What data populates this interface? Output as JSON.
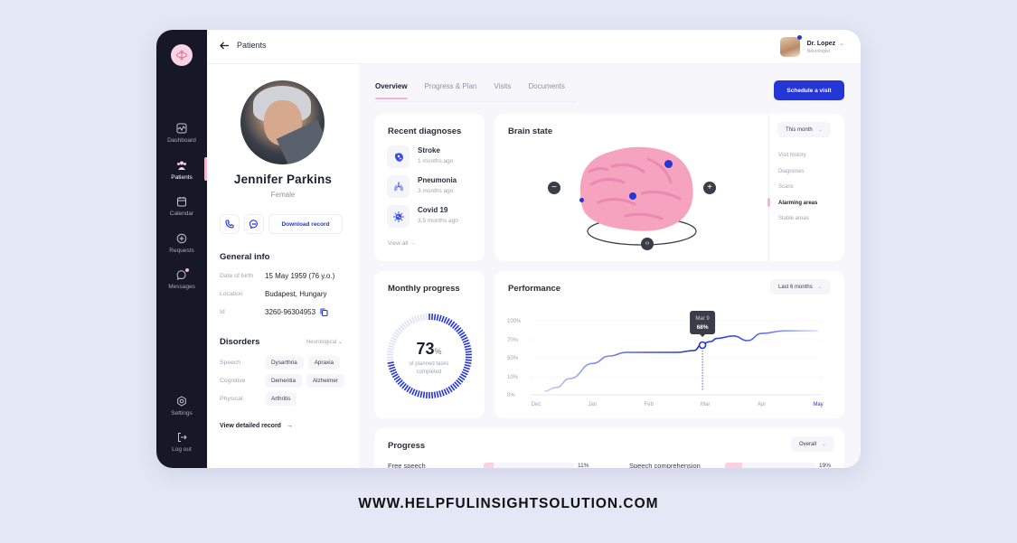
{
  "sidebar": {
    "items": [
      {
        "label": "Dashboard",
        "icon": "dashboard-icon"
      },
      {
        "label": "Patients",
        "icon": "patients-icon",
        "active": true
      },
      {
        "label": "Calendar",
        "icon": "calendar-icon"
      },
      {
        "label": "Requests",
        "icon": "requests-icon"
      },
      {
        "label": "Messages",
        "icon": "messages-icon",
        "badge": true
      }
    ],
    "bottom_items": [
      {
        "label": "Settings",
        "icon": "settings-icon"
      },
      {
        "label": "Log out",
        "icon": "logout-icon"
      }
    ]
  },
  "topbar": {
    "back_label": "Patients",
    "doctor": {
      "name": "Dr. Lopez",
      "role": "Neurologist"
    }
  },
  "patient": {
    "name": "Jennifer Parkins",
    "gender": "Female",
    "download_label": "Download record",
    "general_info_title": "General info",
    "info": [
      {
        "key": "Date of birth",
        "value": "15 May 1959 (76 y.o.)"
      },
      {
        "key": "Location",
        "value": "Budapest, Hungary"
      },
      {
        "key": "Id",
        "value": "3260-96304953"
      }
    ],
    "disorders_title": "Disorders",
    "disorders_filter": "Neurological",
    "disorders": [
      {
        "category": "Speech",
        "tags": [
          "Dysarthria",
          "Apraxia"
        ]
      },
      {
        "category": "Cognitive",
        "tags": [
          "Dementia",
          "Alzheimer"
        ]
      },
      {
        "category": "Physical",
        "tags": [
          "Arthritis"
        ]
      }
    ],
    "view_record_label": "View detailed record"
  },
  "tabs": [
    {
      "label": "Overview",
      "active": true
    },
    {
      "label": "Progress & Plan"
    },
    {
      "label": "Visits"
    },
    {
      "label": "Documents"
    }
  ],
  "schedule_label": "Schedule a visit",
  "recent_diagnoses": {
    "title": "Recent diagnoses",
    "items": [
      {
        "name": "Stroke",
        "time": "1 months ago",
        "icon": "stroke-icon"
      },
      {
        "name": "Pneumonia",
        "time": "3 months ago",
        "icon": "lungs-icon"
      },
      {
        "name": "Covid 19",
        "time": "3,5 months ago",
        "icon": "virus-icon"
      }
    ],
    "view_all": "View all"
  },
  "brain_state": {
    "title": "Brain state",
    "period": "This month",
    "menu": [
      {
        "label": "Visit history"
      },
      {
        "label": "Diagnoses"
      },
      {
        "label": "Scans"
      },
      {
        "label": "Alarming areas",
        "active": true
      },
      {
        "label": "Stable areas"
      }
    ]
  },
  "monthly_progress": {
    "title": "Monthly progress",
    "percent": 73,
    "percent_sign": "%",
    "caption_line1": "of planned tasks",
    "caption_line2": "completed"
  },
  "performance": {
    "title": "Performance",
    "period": "Last 6 months",
    "tooltip": {
      "date": "Mar 9",
      "value": "68%"
    }
  },
  "progress": {
    "title": "Progress",
    "filter": "Overall",
    "items": [
      {
        "label": "Free speech",
        "value": "11%",
        "fraction": 0.11
      },
      {
        "label": "Speech comprehension",
        "value": "19%",
        "fraction": 0.19
      }
    ]
  },
  "watermark": "WWW.HELPFULINSIGHTSOLUTION.COM",
  "chart_data": {
    "type": "line",
    "title": "Performance",
    "x": [
      "Dec",
      "Jan",
      "Feb",
      "Mar",
      "Apr",
      "May"
    ],
    "y_ticks": [
      "0%",
      "10%",
      "50%",
      "70%",
      "100%"
    ],
    "highlight_x": "May",
    "series": [
      {
        "name": "Performance",
        "points": [
          [
            0.15,
            2
          ],
          [
            0.35,
            4
          ],
          [
            0.6,
            9
          ],
          [
            1.0,
            38
          ],
          [
            1.3,
            52
          ],
          [
            1.6,
            56
          ],
          [
            2.0,
            56
          ],
          [
            2.5,
            56
          ],
          [
            2.8,
            58
          ],
          [
            2.95,
            66
          ],
          [
            3.1,
            68
          ],
          [
            3.2,
            72
          ],
          [
            3.5,
            76
          ],
          [
            3.75,
            69
          ],
          [
            4.0,
            80
          ],
          [
            4.4,
            84
          ],
          [
            5.0,
            84
          ]
        ]
      }
    ],
    "marker": {
      "x": "Mar 9",
      "y": 68
    },
    "ylim": [
      0,
      100
    ]
  }
}
